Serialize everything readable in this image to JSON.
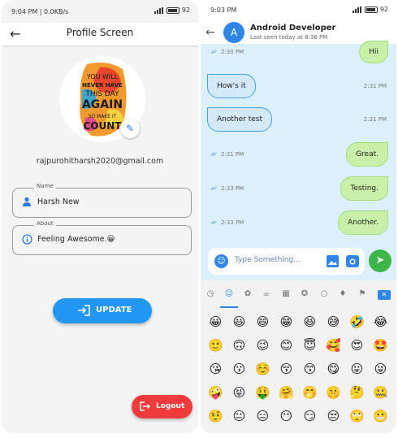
{
  "left_screen": {
    "status_time": "9:04 PM | 0.0KB/s",
    "status_battery": "92",
    "title": "Profile Screen",
    "poster_lines": [
      "YOU WILL",
      "NEVER HAVE",
      "THIS DAY",
      "AGAIN",
      "SO MAKE IT",
      "COUNT"
    ],
    "email": "rajpurohitharsh2020@gmail.com",
    "name_field": {
      "label": "Name",
      "value": "Harsh New"
    },
    "about_field": {
      "label": "About",
      "value": "Feeling Awesome.😀"
    },
    "update_label": "UPDATE",
    "logout_label": "Logout",
    "accent": "#2196f3",
    "logout_color": "#ef3b3b"
  },
  "right_screen": {
    "status_time": "9:03 PM",
    "status_battery": "92",
    "contact_initial": "A",
    "contact_name": "Android Developer",
    "contact_status": "Last seen today at 8:36 PM",
    "messages": [
      {
        "dir": "out",
        "text": "Hii",
        "time": "2:30 PM"
      },
      {
        "dir": "in",
        "text": "How's it",
        "time": "2:31 PM"
      },
      {
        "dir": "in",
        "text": "Another test",
        "time": "2:31 PM"
      },
      {
        "dir": "out",
        "text": "Great.",
        "time": "2:31 PM"
      },
      {
        "dir": "out",
        "text": "Testing.",
        "time": "2:33 PM"
      },
      {
        "dir": "out",
        "text": "Another.",
        "time": "2:33 PM"
      }
    ],
    "input_placeholder": "Type Something...",
    "emoji_categories": [
      "clock-icon",
      "smiley-icon",
      "paw-icon",
      "food-icon",
      "building-icon",
      "running-icon",
      "bulb-icon",
      "symbols-icon",
      "flag-icon",
      "backspace-icon"
    ],
    "emojis": [
      "😀",
      "😃",
      "😄",
      "😁",
      "😆",
      "😅",
      "🤣",
      "😂",
      "🙂",
      "🙃",
      "😉",
      "😊",
      "😇",
      "🥰",
      "😍",
      "🤩",
      "😘",
      "😗",
      "☺️",
      "😚",
      "😙",
      "😋",
      "😛",
      "😜",
      "🤪",
      "😝",
      "🤑",
      "🤗",
      "🤭",
      "🤫",
      "🤔",
      "🤐",
      "🤨",
      "😐",
      "😑",
      "😶",
      "😏",
      "😒",
      "🙄",
      "😬"
    ]
  }
}
